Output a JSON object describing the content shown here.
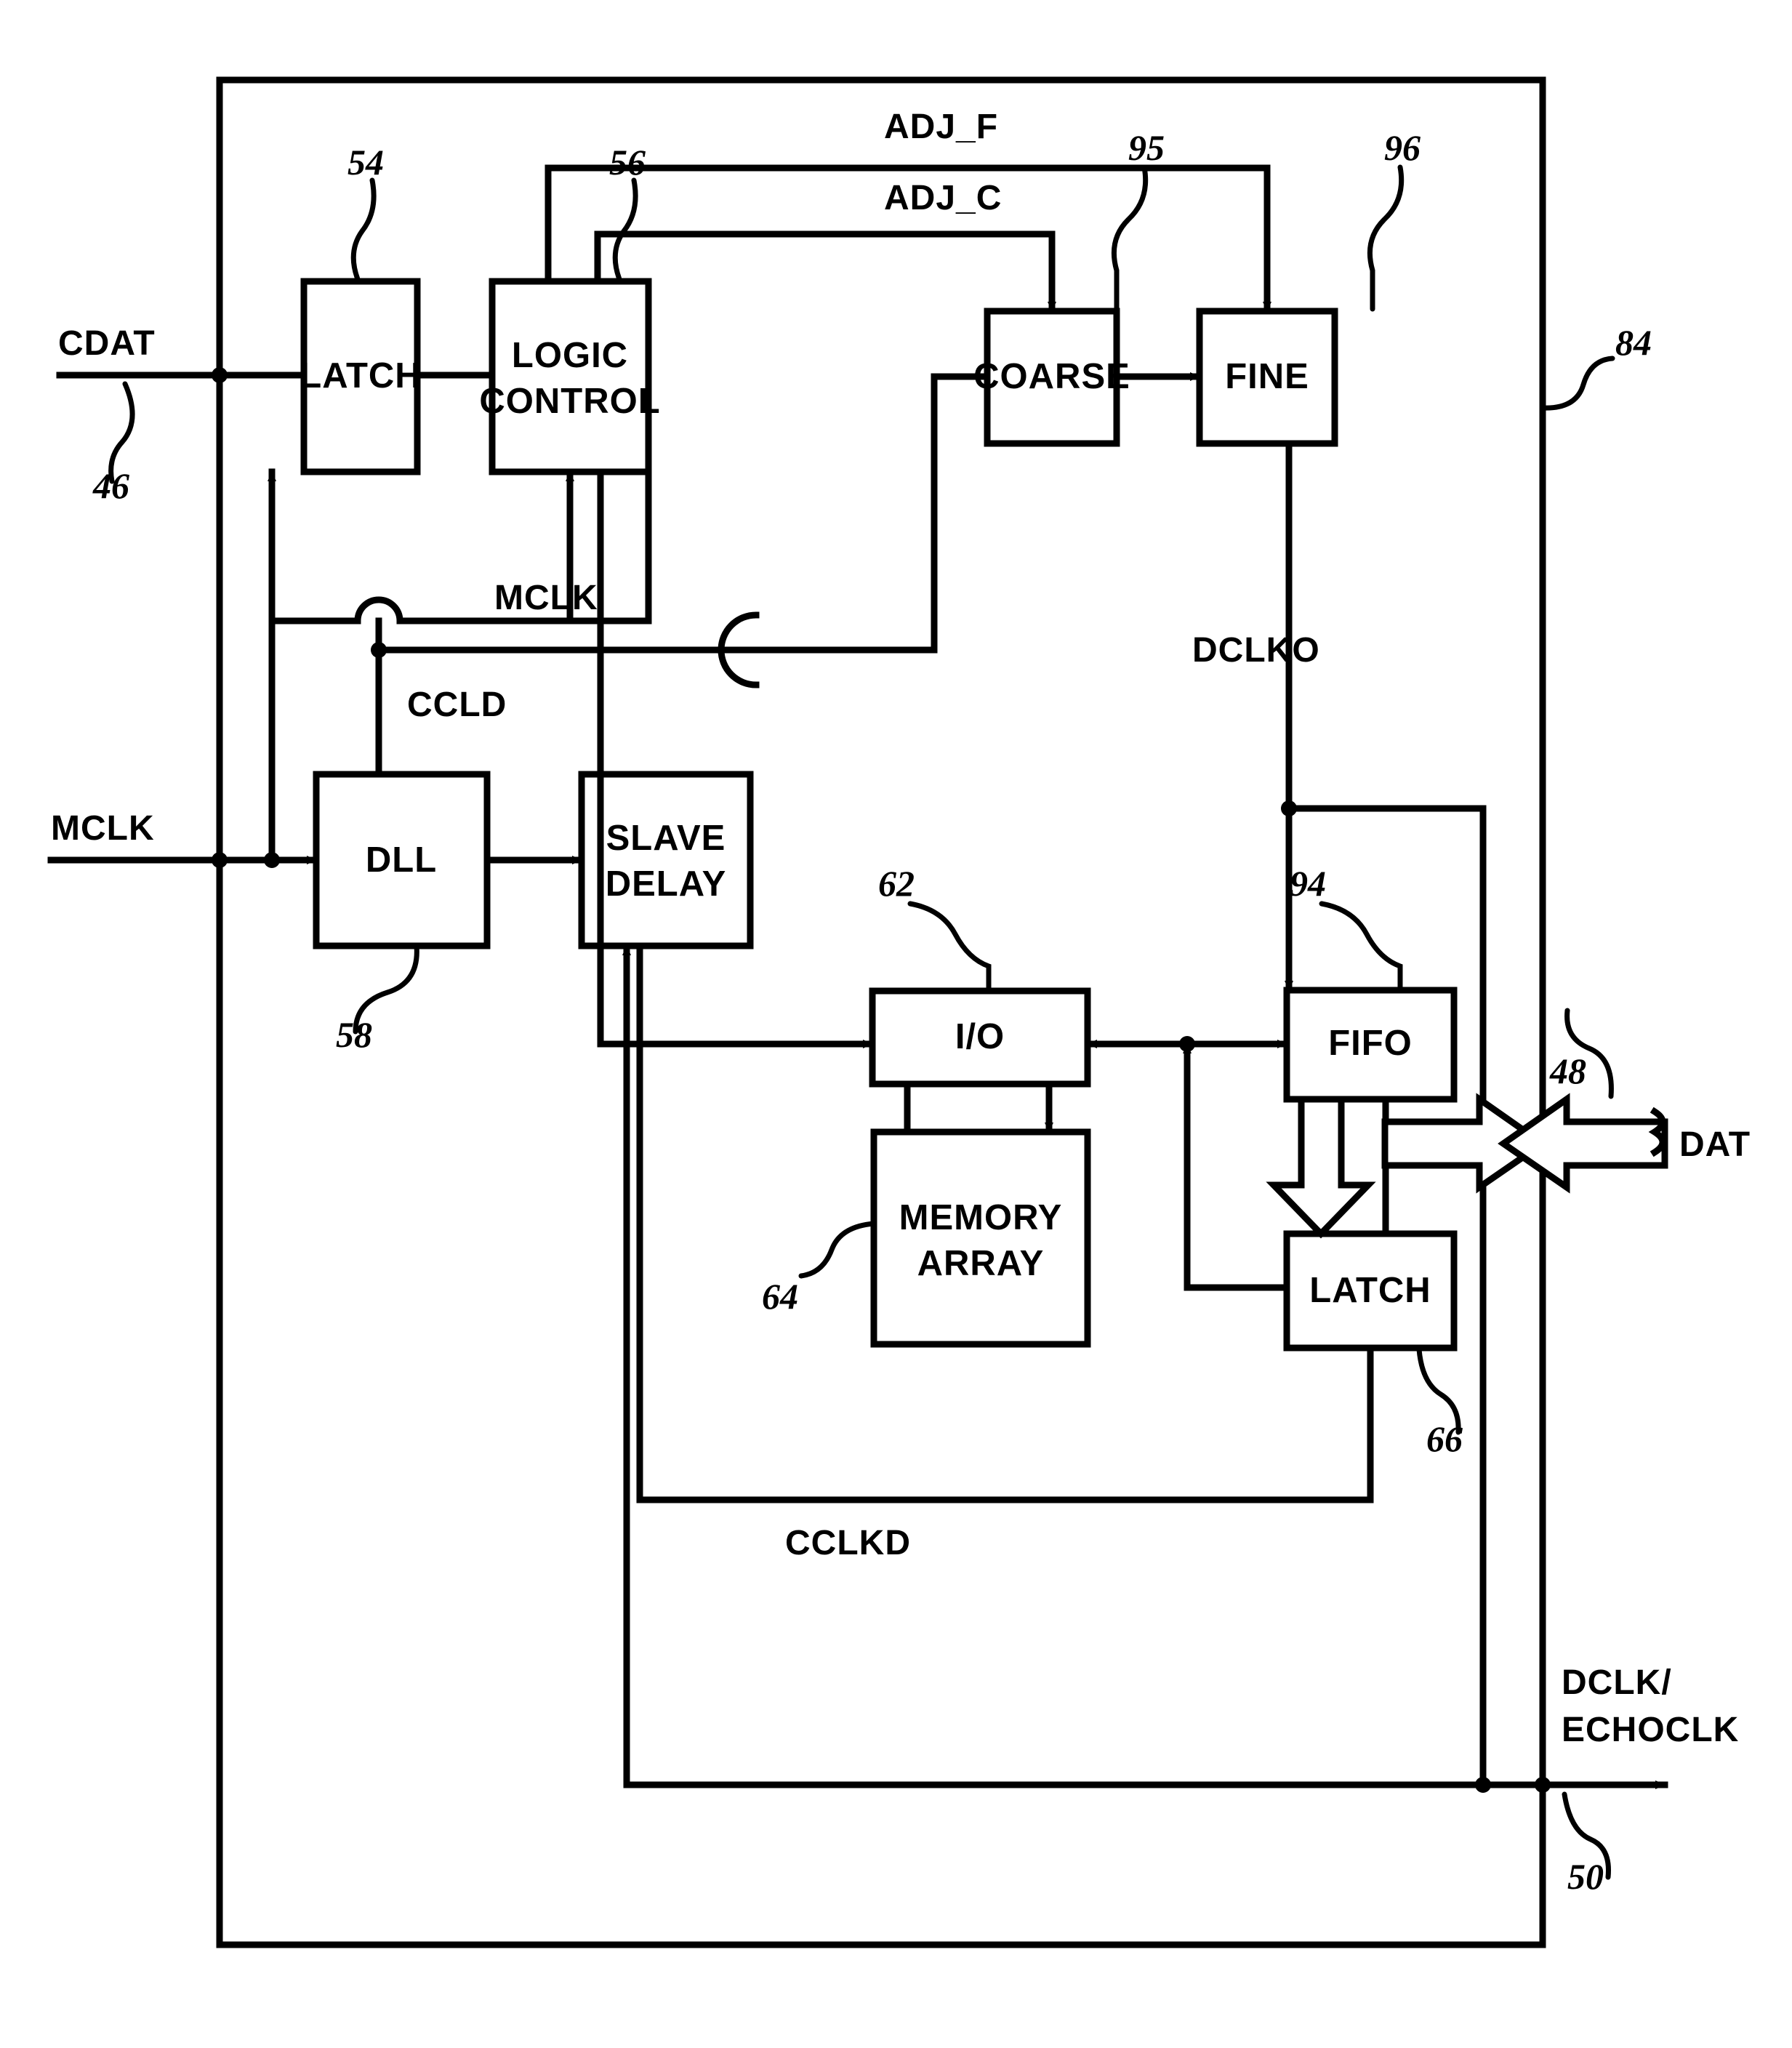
{
  "figure": {
    "type": "patent-block-diagram",
    "outer_boundary_ref": "84"
  },
  "blocks": [
    {
      "id": "latch_in",
      "label": "LATCH",
      "ref": "54"
    },
    {
      "id": "logic",
      "label": "LOGIC",
      "label2": "CONTROL",
      "ref": "56"
    },
    {
      "id": "coarse",
      "label": "COARSE",
      "ref": "95"
    },
    {
      "id": "fine",
      "label": "FINE",
      "ref": "96"
    },
    {
      "id": "dll",
      "label": "DLL",
      "ref": "58"
    },
    {
      "id": "slave",
      "label": "SLAVE",
      "label2": "DELAY",
      "ref": ""
    },
    {
      "id": "io",
      "label": "I/O",
      "ref": "62"
    },
    {
      "id": "memory",
      "label": "MEMORY",
      "label2": "ARRAY",
      "ref": "64"
    },
    {
      "id": "fifo",
      "label": "FIFO",
      "ref": "94"
    },
    {
      "id": "latch_out",
      "label": "LATCH",
      "ref": "66"
    }
  ],
  "signals": {
    "cdat": "CDAT",
    "adj_f": "ADJ_F",
    "adj_c": "ADJ_C",
    "mclk_internal": "MCLK",
    "mclk_input": "MCLK",
    "ccld": "CCLD",
    "dclko": "DCLKO",
    "cclkd": "CCLKD",
    "dat": "DAT",
    "dclk_echoclk_line1": "DCLK/",
    "dclk_echoclk_line2": "ECHOCLK"
  },
  "reference_numerals": {
    "cdat_port": "46",
    "dat_port": "48",
    "dclk_port": "50",
    "latch_in": "54",
    "logic_control": "56",
    "dll": "58",
    "io": "62",
    "memory_array": "64",
    "latch_out": "66",
    "outer": "84",
    "fifo": "94",
    "coarse": "95",
    "fine": "96"
  },
  "colors": {
    "ink": "#000000",
    "paper": "#ffffff"
  }
}
